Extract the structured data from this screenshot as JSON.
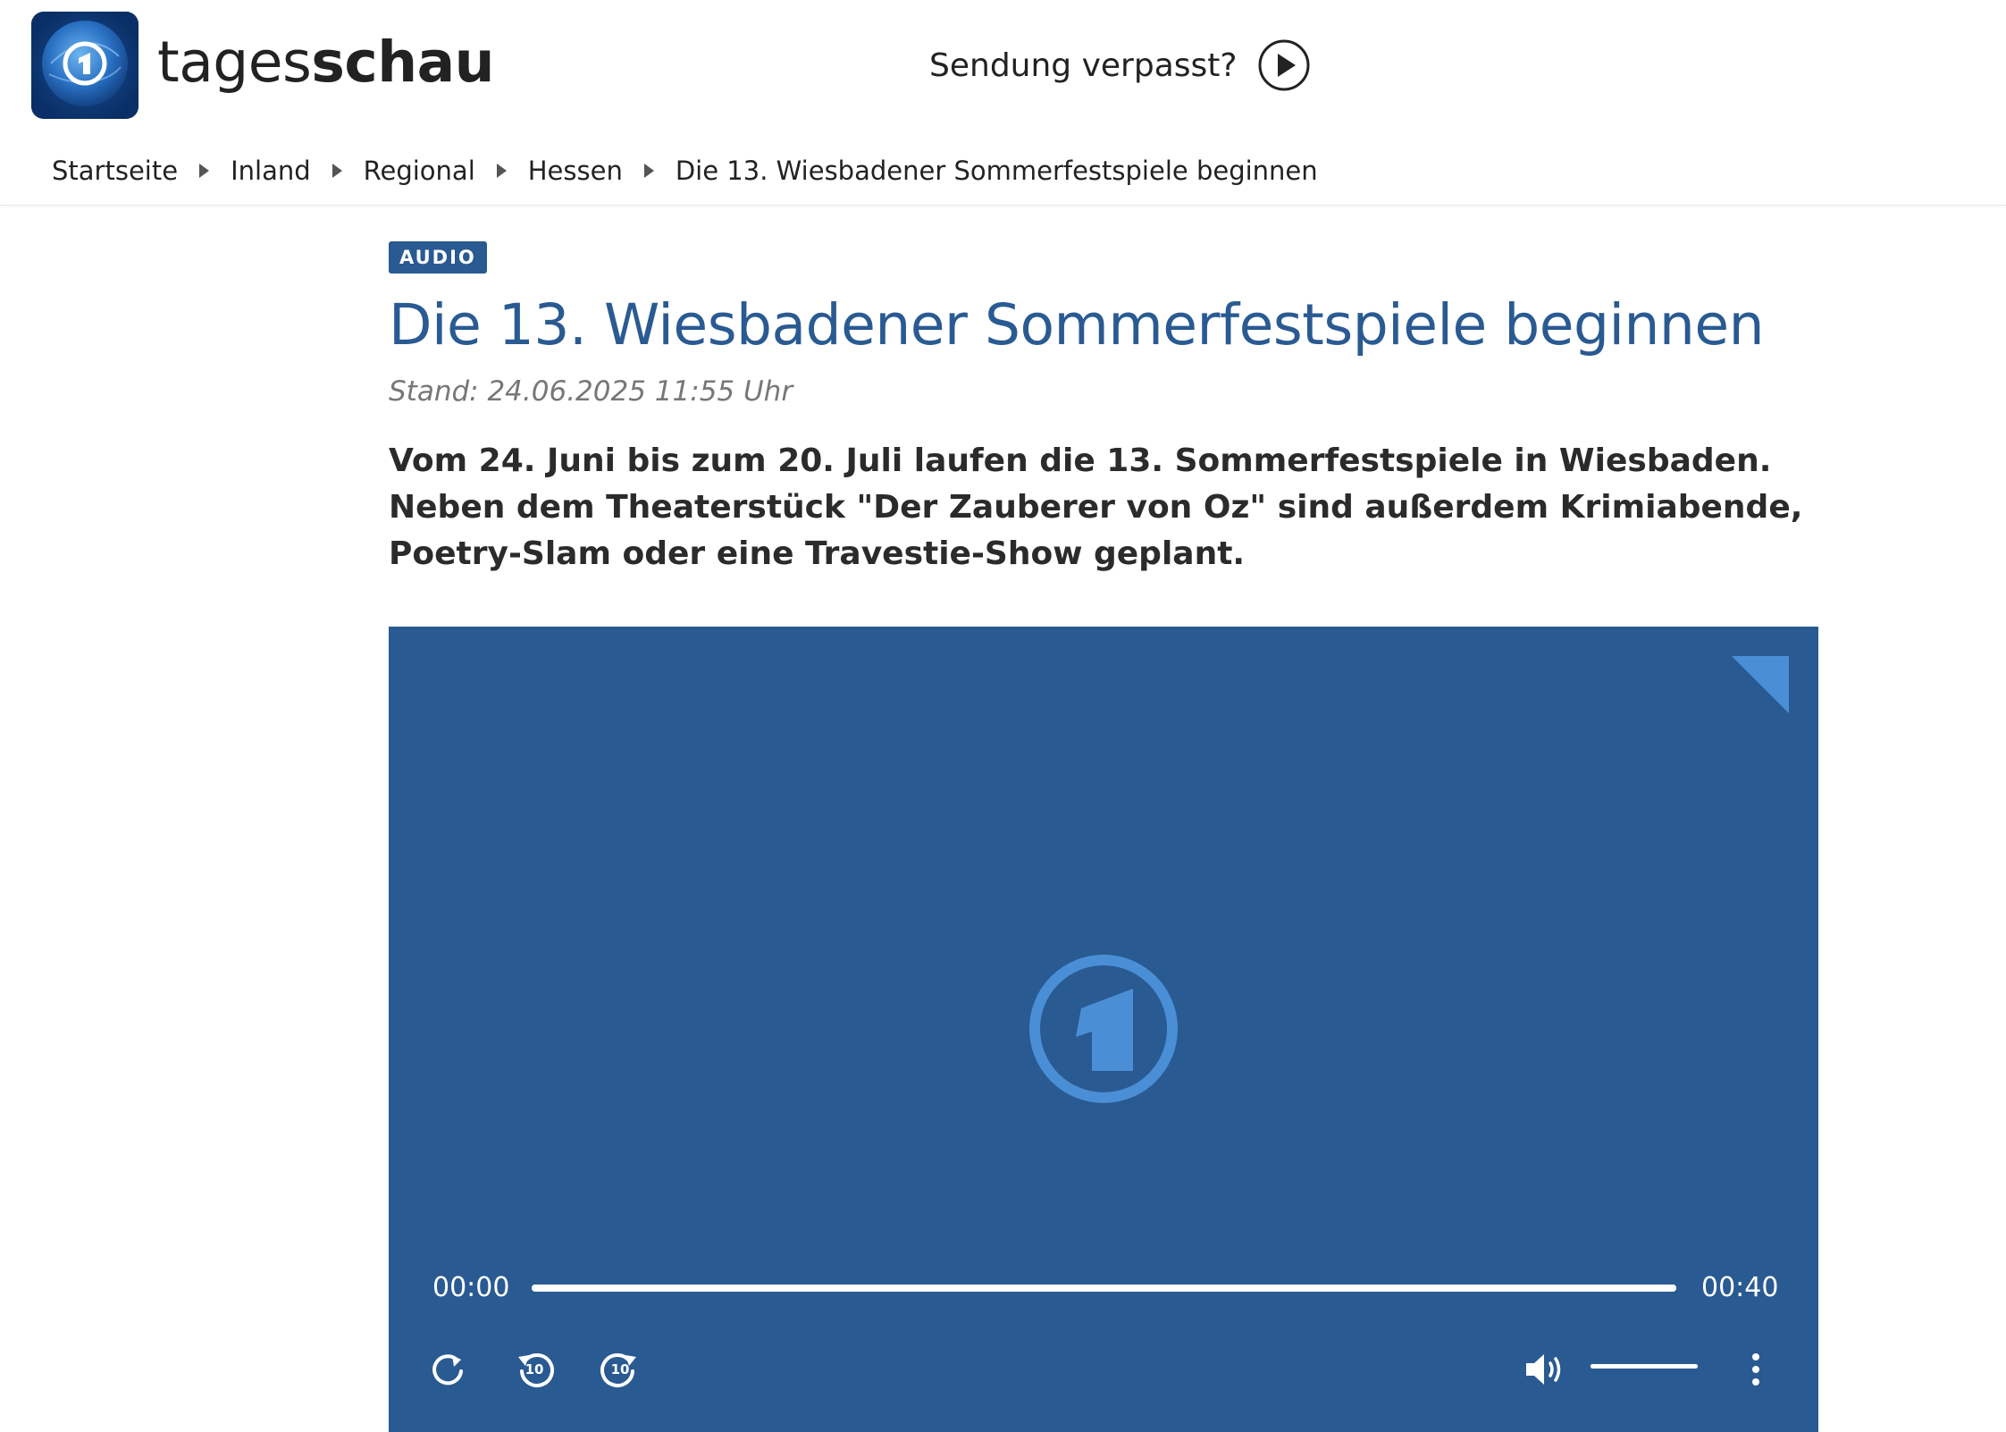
{
  "header": {
    "brand_light": "tages",
    "brand_bold": "schau",
    "missed_label": "Sendung verpasst?"
  },
  "breadcrumb": [
    {
      "label": "Startseite"
    },
    {
      "label": "Inland"
    },
    {
      "label": "Regional"
    },
    {
      "label": "Hessen"
    },
    {
      "label": "Die 13. Wiesbadener Sommerfestspiele beginnen"
    }
  ],
  "article": {
    "badge": "AUDIO",
    "title": "Die 13. Wiesbadener Sommerfestspiele beginnen",
    "stand": "Stand: 24.06.2025 11:55 Uhr",
    "lead": "Vom 24. Juni bis zum 20. Juli laufen die 13. Sommerfestspiele in Wiesbaden. Neben dem Theaterstück \"Der Zauberer von Oz\" sind außerdem Krimiabende, Poetry-Slam oder eine Travestie-Show geplant."
  },
  "player": {
    "time_current": "00:00",
    "time_total": "00:40",
    "progress_fraction": 1.0,
    "volume_fraction": 1.0,
    "skip_back_label": "10",
    "skip_forward_label": "10"
  },
  "colors": {
    "brand_blue": "#2a5a92",
    "logo_blue": "#1d5aa3",
    "player_accent": "#4a8fd6"
  },
  "icons": [
    "tagesschau-logo-icon",
    "play-circle-icon",
    "breadcrumb-arrow-icon",
    "ard-corner-icon",
    "ard-one-logo-icon",
    "replay-icon",
    "rewind-10-icon",
    "forward-10-icon",
    "volume-icon",
    "more-vertical-icon"
  ]
}
